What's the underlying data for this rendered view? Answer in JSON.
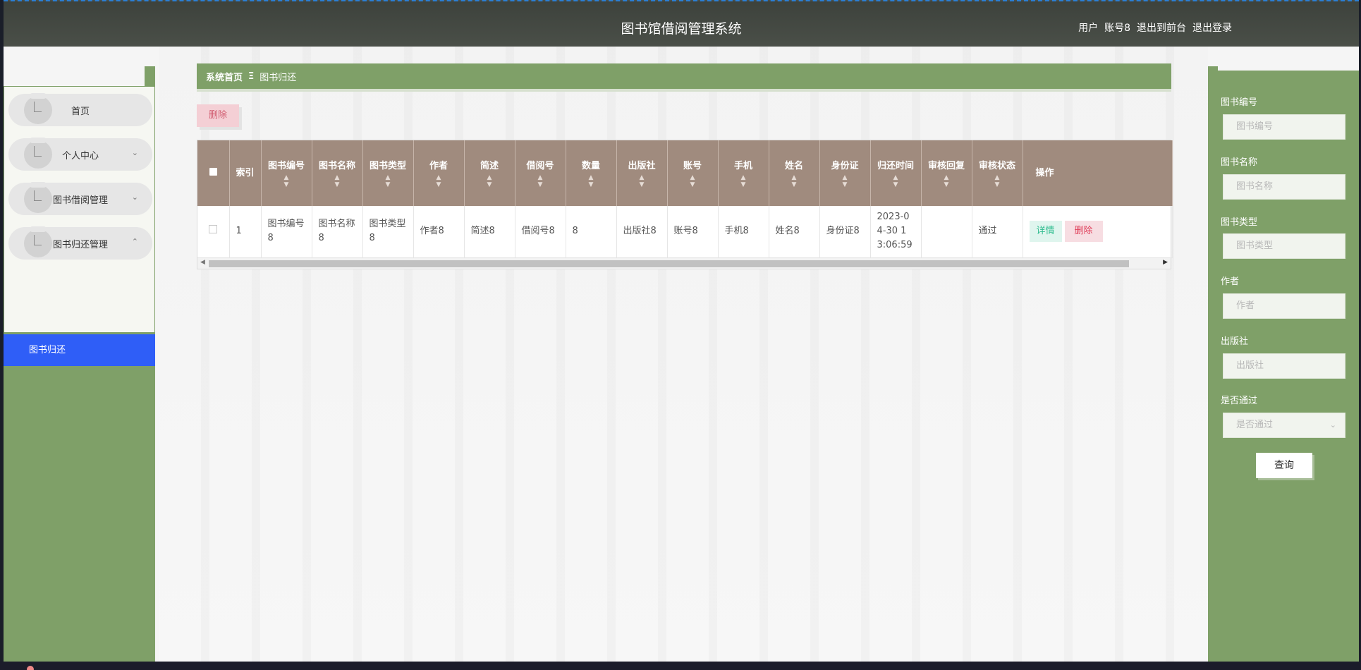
{
  "header": {
    "title": "图书馆借阅管理系统",
    "user_role": "用户",
    "username": "账号8",
    "to_front": "退出到前台",
    "logout": "退出登录"
  },
  "sidebar": {
    "items": [
      {
        "label": "首页",
        "expandable": false
      },
      {
        "label": "个人中心",
        "expandable": true,
        "chevron": "chevron-down-icon"
      },
      {
        "label": "图书借阅管理",
        "expandable": true,
        "chevron": "chevron-down-icon"
      },
      {
        "label": "图书归还管理",
        "expandable": true,
        "chevron": "chevron-up-icon"
      }
    ],
    "active_sub": "图书归还"
  },
  "breadcrumb": {
    "home": "系统首页",
    "separator": "Ξ",
    "current": "图书归还"
  },
  "toolbar": {
    "delete_label": "删除"
  },
  "table": {
    "headers": [
      {
        "label": "",
        "sortable": false
      },
      {
        "label": "索引",
        "sortable": false
      },
      {
        "label": "图书编号",
        "sortable": true
      },
      {
        "label": "图书名称",
        "sortable": true
      },
      {
        "label": "图书类型",
        "sortable": true
      },
      {
        "label": "作者",
        "sortable": true
      },
      {
        "label": "简述",
        "sortable": true
      },
      {
        "label": "借阅号",
        "sortable": true
      },
      {
        "label": "数量",
        "sortable": true
      },
      {
        "label": "出版社",
        "sortable": true
      },
      {
        "label": "账号",
        "sortable": true
      },
      {
        "label": "手机",
        "sortable": true
      },
      {
        "label": "姓名",
        "sortable": true
      },
      {
        "label": "身份证",
        "sortable": true
      },
      {
        "label": "归还时间",
        "sortable": true
      },
      {
        "label": "审核回复",
        "sortable": true
      },
      {
        "label": "审核状态",
        "sortable": true
      },
      {
        "label": "操作",
        "sortable": false
      }
    ],
    "rows": [
      {
        "index": "1",
        "book_no": "图书编号8",
        "book_name": "图书名称8",
        "book_type": "图书类型8",
        "author": "作者8",
        "summary": "简述8",
        "borrow_no": "借阅号8",
        "quantity": "8",
        "publisher": "出版社8",
        "account": "账号8",
        "phone": "手机8",
        "name": "姓名8",
        "id_card": "身份证8",
        "return_time": "2023-04-30 13:06:59",
        "review_reply": "",
        "review_status": "通过",
        "detail_label": "详情",
        "delete_label": "删除"
      }
    ]
  },
  "search": {
    "fields": [
      {
        "label": "图书编号",
        "placeholder": "图书编号"
      },
      {
        "label": "图书名称",
        "placeholder": "图书名称"
      },
      {
        "label": "图书类型",
        "placeholder": "图书类型"
      },
      {
        "label": "作者",
        "placeholder": "作者"
      },
      {
        "label": "出版社",
        "placeholder": "出版社"
      }
    ],
    "select": {
      "label": "是否通过",
      "placeholder": "是否通过"
    },
    "query_label": "查询"
  },
  "colors": {
    "header_bg": "#444842",
    "sidebar_bg": "#7fa068",
    "table_header_bg": "#a08b7e",
    "active_blue": "#2f5ef7"
  }
}
